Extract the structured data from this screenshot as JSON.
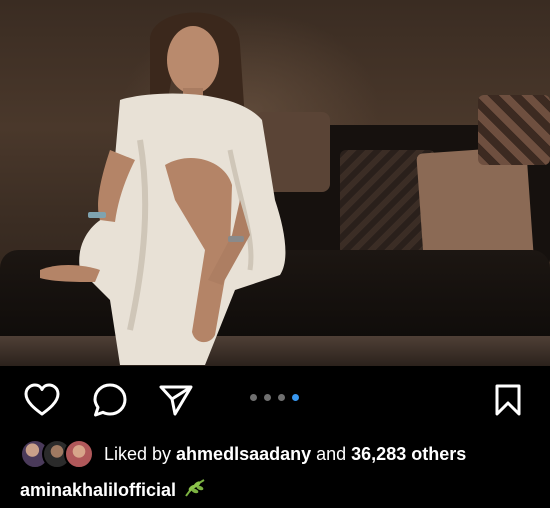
{
  "post": {
    "image_alt": "Woman in a white dress seated on a dark sofa",
    "carousel": {
      "total": 4,
      "active_index": 3
    }
  },
  "actions": {
    "like_icon": "heart-outline-icon",
    "comment_icon": "comment-bubble-icon",
    "share_icon": "paper-plane-icon",
    "save_icon": "bookmark-outline-icon"
  },
  "likes": {
    "prefix": "Liked by ",
    "user": "ahmedlsaadany",
    "connector": " and ",
    "count": "36,283 others"
  },
  "caption": {
    "username": "aminakhalilofficial",
    "emoji_icon": "herb-leaf-icon"
  },
  "colors": {
    "background": "#000000",
    "text": "#ffffff",
    "active_dot": "#3897f0",
    "inactive_dot": "#6f6f6f"
  }
}
